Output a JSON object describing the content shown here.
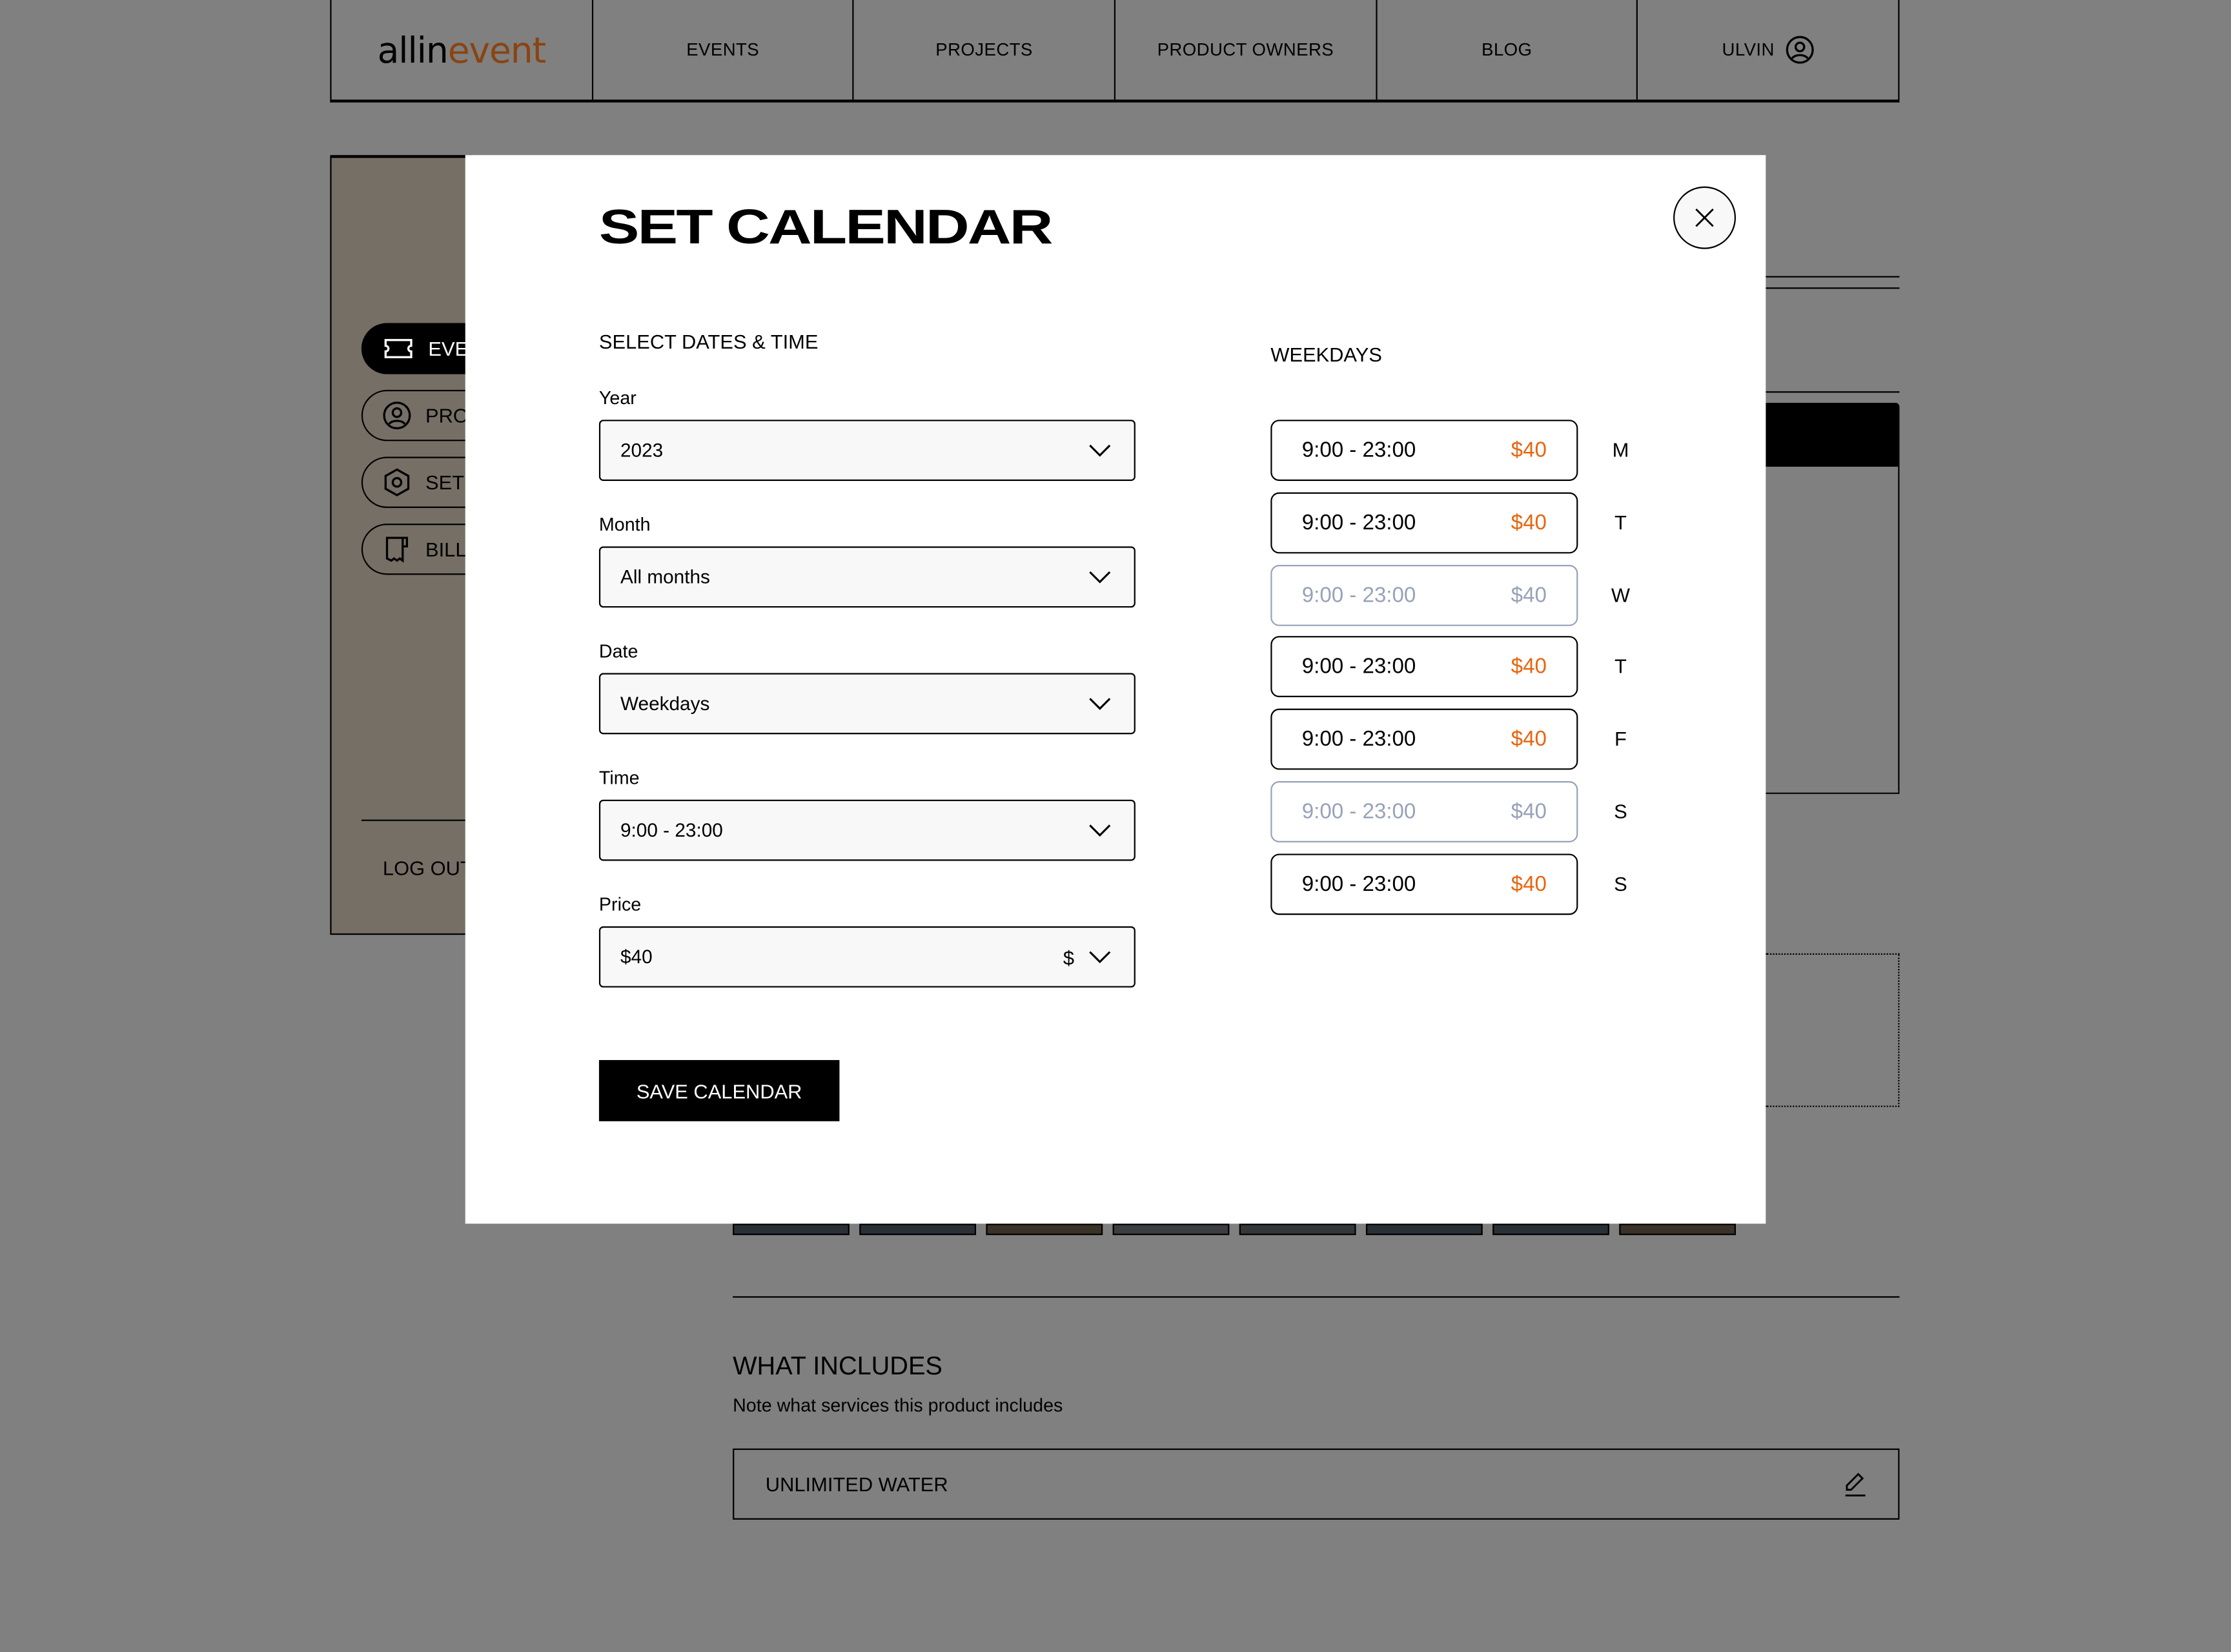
{
  "header": {
    "logo_a": "allin",
    "logo_b": "event",
    "nav": [
      "EVENTS",
      "PROJECTS",
      "PRODUCT OWNERS",
      "BLOG"
    ],
    "user": "ULVIN"
  },
  "sidebar": {
    "items": [
      {
        "label": "EVE"
      },
      {
        "label": "PRO"
      },
      {
        "label": "SET"
      },
      {
        "label": "BILL"
      }
    ],
    "logout": "LOG OUT"
  },
  "modal": {
    "title": "SET CALENDAR",
    "section": "SELECT DATES & TIME",
    "fields": [
      {
        "label": "Year",
        "value": "2023"
      },
      {
        "label": "Month",
        "value": "All months"
      },
      {
        "label": "Date",
        "value": "Weekdays"
      },
      {
        "label": "Time",
        "value": "9:00 - 23:00"
      },
      {
        "label": "Price",
        "value": "$40",
        "currency": "$"
      }
    ],
    "save_label": "SAVE CALENDAR",
    "weekdays_title": "WEEKDAYS",
    "weekdays": [
      {
        "day": "M",
        "time": "9:00 - 23:00",
        "price": "$40",
        "enabled": true
      },
      {
        "day": "T",
        "time": "9:00 - 23:00",
        "price": "$40",
        "enabled": true
      },
      {
        "day": "W",
        "time": "9:00 - 23:00",
        "price": "$40",
        "enabled": false
      },
      {
        "day": "T",
        "time": "9:00 - 23:00",
        "price": "$40",
        "enabled": true
      },
      {
        "day": "F",
        "time": "9:00 - 23:00",
        "price": "$40",
        "enabled": true
      },
      {
        "day": "S",
        "time": "9:00 - 23:00",
        "price": "$40",
        "enabled": false
      },
      {
        "day": "S",
        "time": "9:00 - 23:00",
        "price": "$40",
        "enabled": true
      }
    ]
  },
  "background": {
    "includes_title": "WHAT INCLUDES",
    "includes_note": "Note what services this product includes",
    "include_item": "UNLIMITED WATER"
  },
  "colors": {
    "accent": "#e8650f",
    "brand": "#8a4412",
    "disabled": "#97a2b8"
  }
}
